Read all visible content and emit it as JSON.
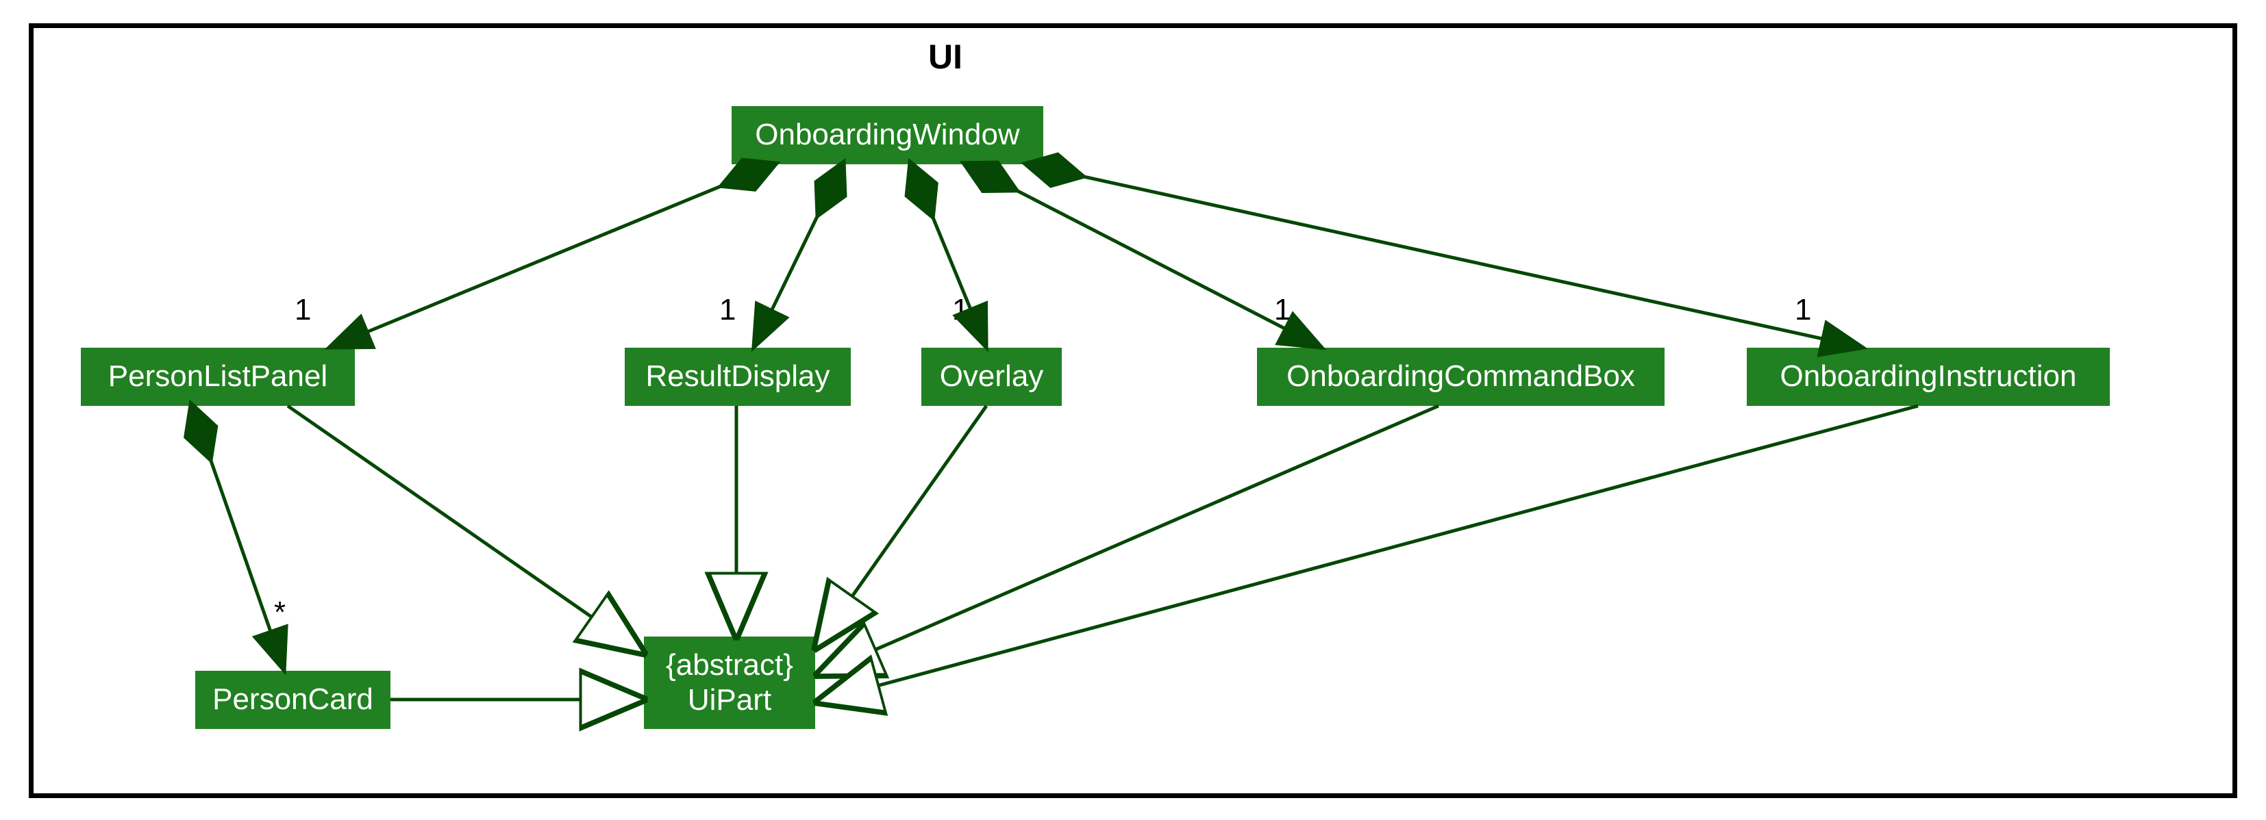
{
  "diagram": {
    "title": "UI",
    "colors": {
      "box_fill": "#218021",
      "box_text": "#ffffff",
      "edge": "#064706",
      "frame_border": "#000000"
    },
    "classes": {
      "onboarding_window": {
        "label": "OnboardingWindow"
      },
      "person_list_panel": {
        "label": "PersonListPanel"
      },
      "result_display": {
        "label": "ResultDisplay"
      },
      "overlay": {
        "label": "Overlay"
      },
      "onboarding_command_box": {
        "label": "OnboardingCommandBox"
      },
      "onboarding_instruction": {
        "label": "OnboardingInstruction"
      },
      "person_card": {
        "label": "PersonCard"
      },
      "ui_part_line1": "{abstract}",
      "ui_part_line2": "UiPart"
    },
    "multiplicities": {
      "m_plp": "1",
      "m_rd": "1",
      "m_ov": "1",
      "m_ocb": "1",
      "m_oi": "1",
      "m_pc": "*"
    },
    "relationships": [
      {
        "from": "OnboardingWindow",
        "to": "PersonListPanel",
        "type": "composition",
        "multiplicity_to": "1"
      },
      {
        "from": "OnboardingWindow",
        "to": "ResultDisplay",
        "type": "composition",
        "multiplicity_to": "1"
      },
      {
        "from": "OnboardingWindow",
        "to": "Overlay",
        "type": "composition",
        "multiplicity_to": "1"
      },
      {
        "from": "OnboardingWindow",
        "to": "OnboardingCommandBox",
        "type": "composition",
        "multiplicity_to": "1"
      },
      {
        "from": "OnboardingWindow",
        "to": "OnboardingInstruction",
        "type": "composition",
        "multiplicity_to": "1"
      },
      {
        "from": "PersonListPanel",
        "to": "PersonCard",
        "type": "composition",
        "multiplicity_to": "*"
      },
      {
        "from": "PersonListPanel",
        "to": "UiPart",
        "type": "inheritance"
      },
      {
        "from": "ResultDisplay",
        "to": "UiPart",
        "type": "inheritance"
      },
      {
        "from": "Overlay",
        "to": "UiPart",
        "type": "inheritance"
      },
      {
        "from": "OnboardingCommandBox",
        "to": "UiPart",
        "type": "inheritance"
      },
      {
        "from": "OnboardingInstruction",
        "to": "UiPart",
        "type": "inheritance"
      },
      {
        "from": "PersonCard",
        "to": "UiPart",
        "type": "inheritance"
      }
    ]
  }
}
